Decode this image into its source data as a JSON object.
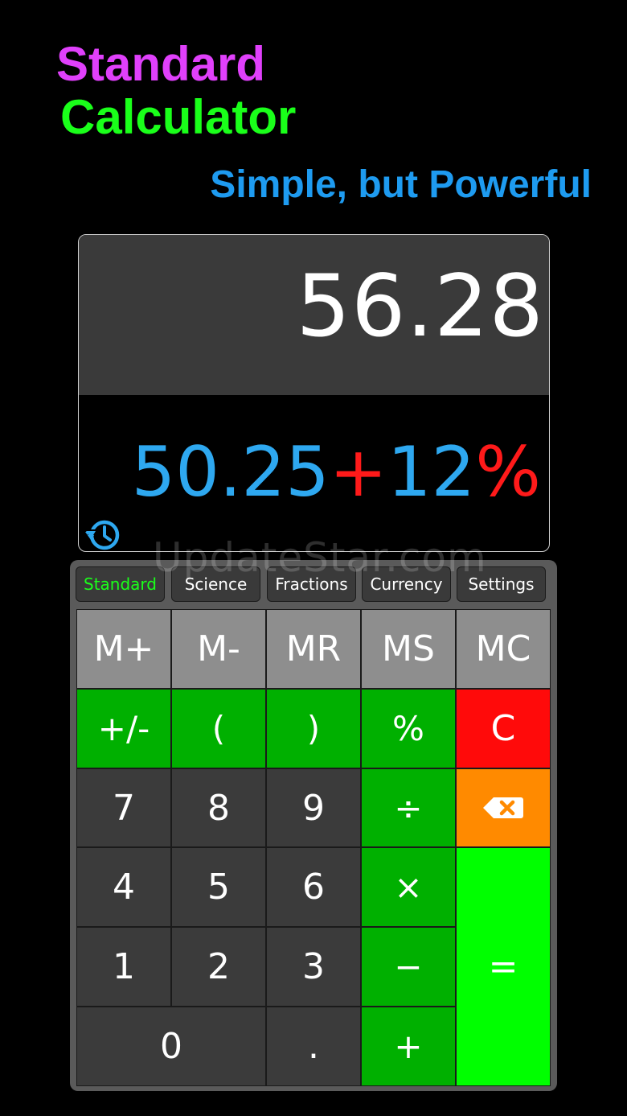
{
  "promo": {
    "line1": "Standard",
    "line2": "Calculator",
    "tagline": "Simple, but Powerful"
  },
  "display": {
    "result": "56.28",
    "expression": {
      "operand1": "50.25",
      "operator": "+",
      "operand2": "12",
      "percent": "%"
    }
  },
  "watermark": "UpdateStar.com",
  "tabs": [
    {
      "label": "Standard",
      "active": true
    },
    {
      "label": "Science",
      "active": false
    },
    {
      "label": "Fractions",
      "active": false
    },
    {
      "label": "Currency",
      "active": false
    },
    {
      "label": "Settings",
      "active": false
    }
  ],
  "keys": {
    "m_plus": "M+",
    "m_minus": "M-",
    "mr": "MR",
    "ms": "MS",
    "mc": "MC",
    "plus_minus": "+/-",
    "open_paren": "(",
    "close_paren": ")",
    "percent": "%",
    "clear": "C",
    "seven": "7",
    "eight": "8",
    "nine": "9",
    "divide": "÷",
    "four": "4",
    "five": "5",
    "six": "6",
    "multiply": "×",
    "one": "1",
    "two": "2",
    "three": "3",
    "subtract": "−",
    "zero": "0",
    "decimal": ".",
    "add": "+",
    "equals": "="
  },
  "colors": {
    "promo_line1": "#e040fb",
    "promo_line2": "#1aff1a",
    "tagline": "#1e9bf0",
    "expression_number": "#2ea8f0",
    "expression_operator": "#ff1a1a",
    "memory_key": "#8e8e8e",
    "function_key": "#00b000",
    "clear_key": "#ff0a0a",
    "backspace_key": "#ff8a00",
    "number_key": "#3b3b3b",
    "equals_key": "#00ff00",
    "active_tab_text": "#1aff1a"
  },
  "icons": {
    "history": "history-clock-icon",
    "backspace": "backspace-icon"
  }
}
